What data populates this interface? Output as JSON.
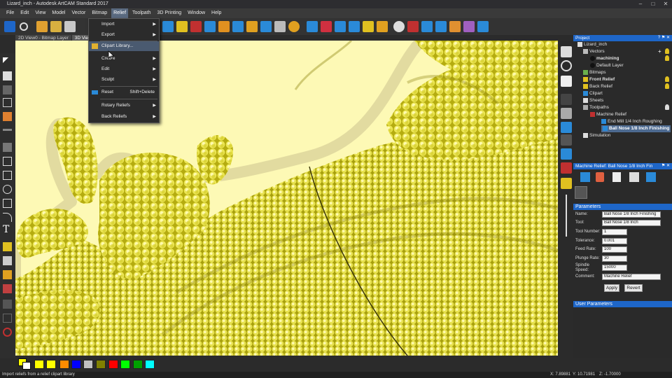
{
  "window": {
    "title": "Lizard_inch - Autodesk ArtCAM Standard 2017"
  },
  "menubar": {
    "items": [
      "File",
      "Edit",
      "View",
      "Model",
      "Vector",
      "Bitmap",
      "Relief",
      "Toolpath",
      "3D Printing",
      "Window",
      "Help"
    ],
    "active": "Relief"
  },
  "view_tabs": [
    "2D View0 - Bitmap Layer",
    "3D View"
  ],
  "relief_menu": {
    "items": [
      {
        "label": "Import",
        "submenu": true
      },
      {
        "label": "Export",
        "submenu": true
      },
      {
        "label": "Clipart Library...",
        "highlighted": true
      },
      {
        "label": "Create",
        "submenu": true
      },
      {
        "label": "Edit",
        "submenu": true
      },
      {
        "label": "Sculpt",
        "submenu": true
      },
      {
        "label": "Reset",
        "shortcut": "Shift+Delete"
      },
      {
        "label": "Rotary Reliefs",
        "submenu": true
      },
      {
        "label": "Back Reliefs",
        "submenu": true
      }
    ]
  },
  "project_panel": {
    "title": "Project",
    "tree": [
      {
        "label": "Lizard_inch"
      },
      {
        "label": "Vectors"
      },
      {
        "label": "machining",
        "bold": true
      },
      {
        "label": "Default Layer"
      },
      {
        "label": "Bitmaps"
      },
      {
        "label": "Front Relief",
        "bold": true
      },
      {
        "label": "Back Relief"
      },
      {
        "label": "Clipart"
      },
      {
        "label": "Sheets"
      },
      {
        "label": "Toolpaths"
      },
      {
        "label": "Machine Relief"
      },
      {
        "label": "End Mill 1/4 Inch Roughing"
      },
      {
        "label": "Ball Nose 1/8 Inch  Finishing",
        "selected": true
      },
      {
        "label": "Simulation"
      }
    ]
  },
  "machine_relief_panel": {
    "title": "Machine Relief: Ball Nose 1/8 Inch Fin",
    "parameters_header": "Parameters",
    "fields": [
      {
        "label": "Name:",
        "value": "Ball Nose 1/8 Inch  Finishing"
      },
      {
        "label": "Tool:",
        "value": "Ball Nose 1/8 Inch"
      },
      {
        "label": "Tool Number:",
        "value": "1"
      },
      {
        "label": "Tolerance:",
        "value": "0.001"
      },
      {
        "label": "Feed Rate:",
        "value": "100"
      },
      {
        "label": "Plunge Rate:",
        "value": "30"
      },
      {
        "label": "Spindle Speed:",
        "value": "15000"
      },
      {
        "label": "Comment:",
        "value": "Machine Relief"
      }
    ],
    "apply_label": "Apply",
    "revert_label": "Revert",
    "user_parameters_header": "User Parameters"
  },
  "palette": {
    "colors": [
      "#ffff00",
      "#ffff00",
      "#ff8c00",
      "#0000ff",
      "#c0c0c0",
      "#808000",
      "#ff0000",
      "#00ff00",
      "#00a000",
      "#00ffff"
    ]
  },
  "status": {
    "message": "Import reliefs from a relief clipart library",
    "x": "X: 7.89881",
    "y": "Y: 10.71981",
    "z": "Z: -1.70000"
  },
  "colors": {
    "accent": "#1e66c8",
    "relief": "#e3dc3a",
    "background": "#fdf9b5"
  }
}
